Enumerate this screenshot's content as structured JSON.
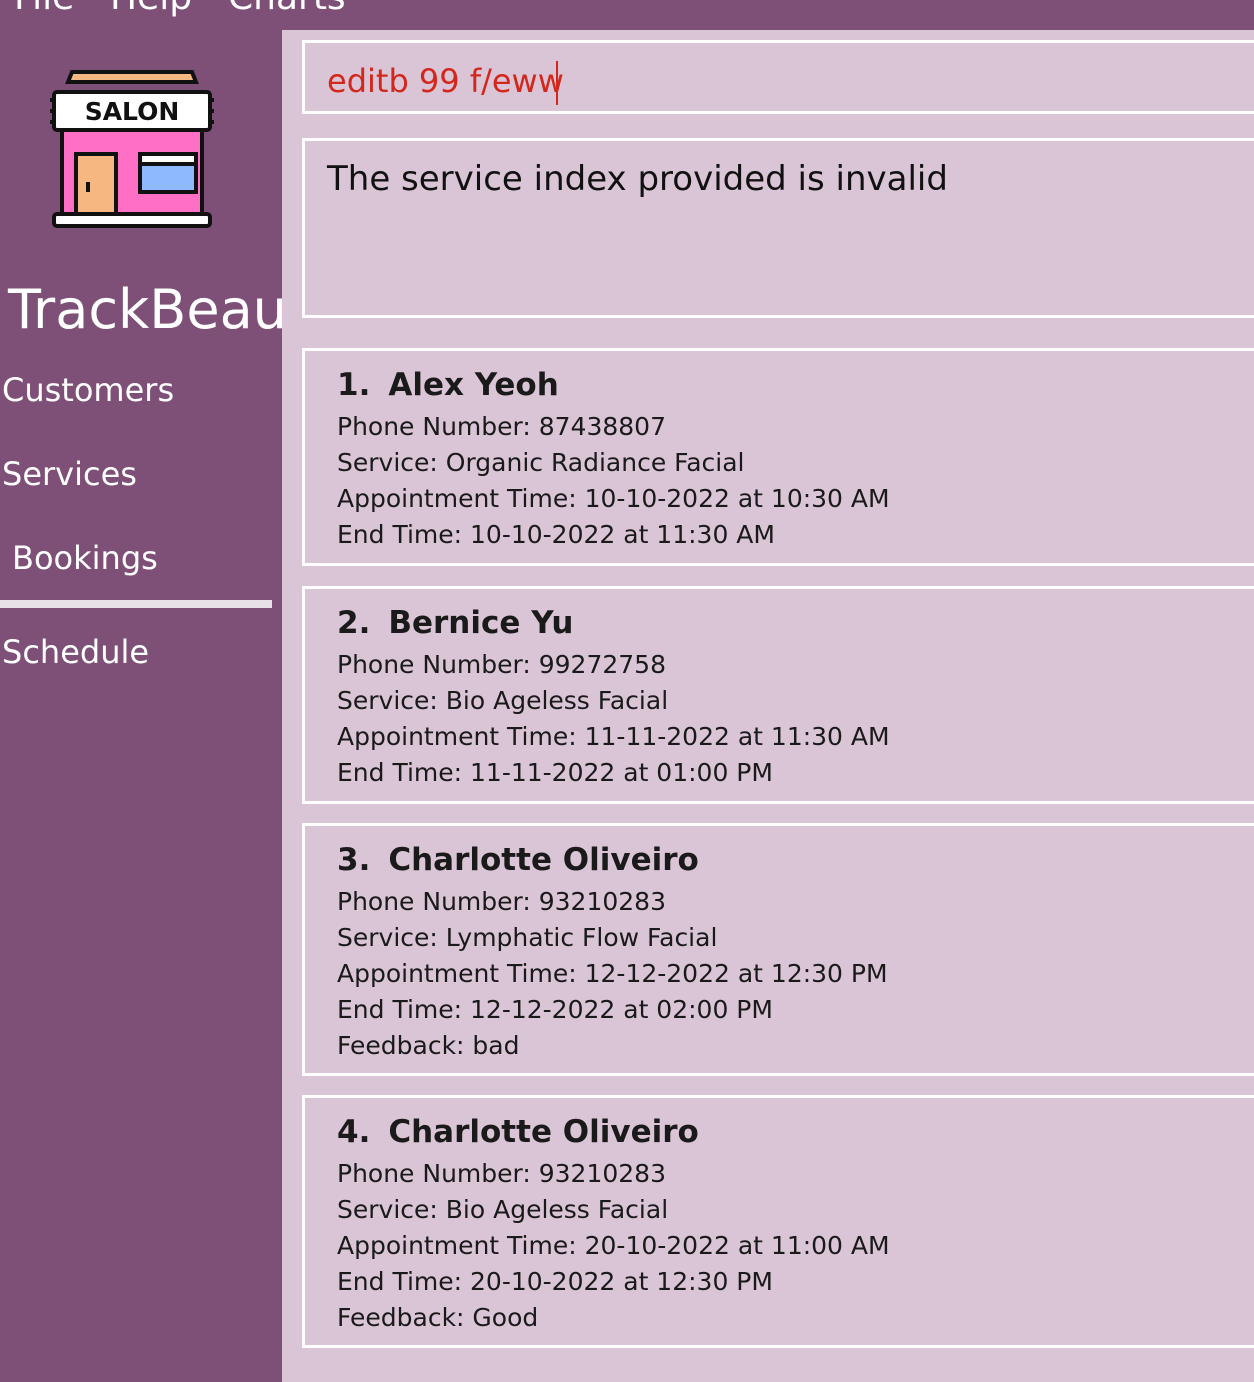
{
  "menu": [
    "File",
    "Help",
    "Charts"
  ],
  "app": {
    "title": "TrackBeau",
    "logo_text": "SALON"
  },
  "sidebar": {
    "items": [
      {
        "label": "Customers"
      },
      {
        "label": "Services"
      },
      {
        "label": "Bookings",
        "selected": true
      },
      {
        "label": "Schedule"
      }
    ]
  },
  "command": {
    "value": "editb 99 f/eww"
  },
  "result": {
    "message": "The service index provided is invalid"
  },
  "bookings": [
    {
      "index": "1.",
      "name": "Alex Yeoh",
      "phone": "Phone Number: 87438807",
      "service": "Service: Organic Radiance Facial",
      "appointment": "Appointment Time: 10-10-2022 at 10:30 AM",
      "end": "End Time: 10-10-2022 at 11:30 AM"
    },
    {
      "index": "2.",
      "name": "Bernice Yu",
      "phone": "Phone Number: 99272758",
      "service": "Service: Bio Ageless Facial",
      "appointment": "Appointment Time: 11-11-2022 at 11:30 AM",
      "end": "End Time: 11-11-2022 at 01:00 PM"
    },
    {
      "index": "3.",
      "name": "Charlotte Oliveiro",
      "phone": "Phone Number: 93210283",
      "service": "Service: Lymphatic Flow Facial",
      "appointment": "Appointment Time: 12-12-2022 at 12:30 PM",
      "end": "End Time: 12-12-2022 at 02:00 PM",
      "feedback": "Feedback: bad"
    },
    {
      "index": "4.",
      "name": "Charlotte Oliveiro",
      "phone": "Phone Number: 93210283",
      "service": "Service: Bio Ageless Facial",
      "appointment": "Appointment Time: 20-10-2022 at 11:00 AM",
      "end": "End Time: 20-10-2022 at 12:30 PM",
      "feedback": "Feedback: Good"
    }
  ],
  "colors": {
    "sidebar_bg": "#7e5077",
    "panel_bg": "#dac5d6",
    "command_text": "#d4271c",
    "border": "#ffffff"
  }
}
